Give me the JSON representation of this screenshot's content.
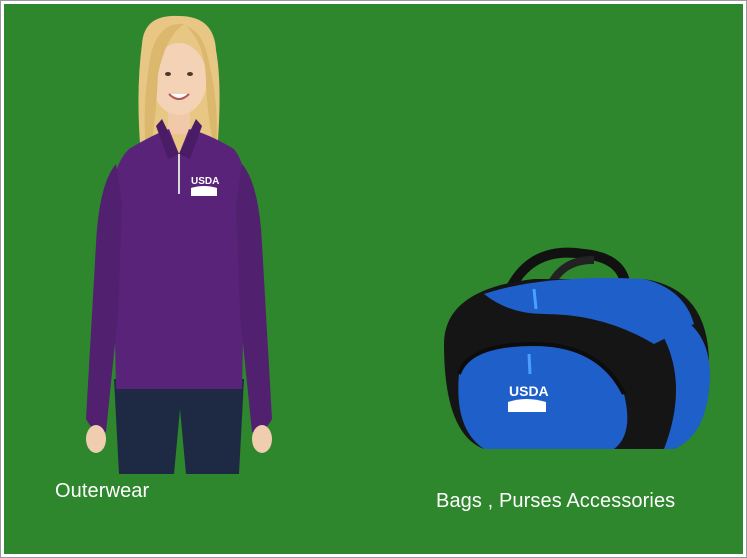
{
  "categories": [
    {
      "id": "outerwear",
      "label": "Outerwear",
      "image": "woman-in-purple-quarter-zip-jacket-with-usda-logo",
      "logo_text": "USDA"
    },
    {
      "id": "bags",
      "label": "Bags , Purses Accessories",
      "image": "black-and-blue-duffel-bag-with-usda-logo",
      "logo_text": "USDA"
    }
  ],
  "colors": {
    "background": "#2e862d",
    "caption_text": "#ffffff",
    "jacket": "#5a237a",
    "bag_blue": "#1f5fc9",
    "bag_black": "#151515"
  }
}
